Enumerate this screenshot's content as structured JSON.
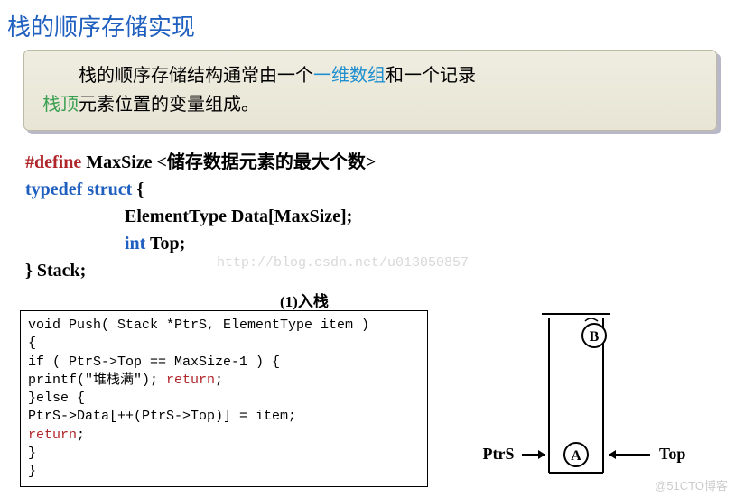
{
  "title": "栈的顺序存储实现",
  "note": {
    "pre1": "栈的顺序存储结构通常由一个",
    "blue1": "一维数组",
    "mid1": "和一个记录",
    "green1": "栈顶",
    "post1": "元素位置的变量组成。"
  },
  "decl": {
    "define_kw": "#define",
    "define_rest": " MaxSize  <储存数据元素的最大个数>",
    "typedef_kw": "typedef",
    "struct_kw": " struct",
    "brace_open": " {",
    "field1": "ElementType Data[MaxSize];",
    "int_kw": "int",
    "top_field": " Top;",
    "close": "} Stack;"
  },
  "section1": "(1)入栈",
  "code": {
    "l1": "void Push( Stack *PtrS, ElementType item )",
    "l2": "{",
    "l3": "    if ( PtrS->Top == MaxSize-1 ) {",
    "l4a": "        printf(\"堆栈满\");  ",
    "l4b": "return",
    "l4c": ";",
    "l5": "    }else {",
    "l6": "        PtrS->Data[++(PtrS->Top)] = item;",
    "l7a": "        ",
    "l7b": "return",
    "l7c": ";",
    "l8": "    }",
    "l9": "}"
  },
  "diagram": {
    "labelB": "B",
    "labelA": "A",
    "ptrs": "PtrS",
    "top": "Top"
  },
  "wm_url": "http://blog.csdn.net/u013050857",
  "wm_bottom": "@51CTO博客"
}
